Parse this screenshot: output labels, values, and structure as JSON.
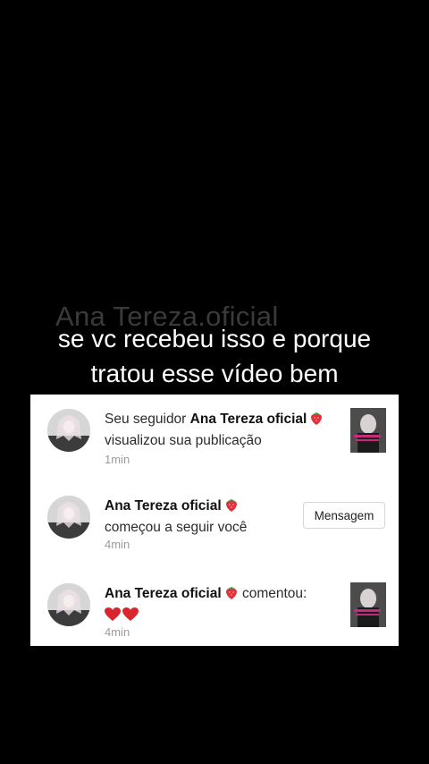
{
  "overlay": {
    "watermark": "Ana Tereza.oficial",
    "caption_line1": "se vc recebeu isso e porque",
    "caption_line2": "tratou esse vídeo bem"
  },
  "notifications": [
    {
      "prefix": "Seu seguidor ",
      "name": "Ana Tereza oficial",
      "icon": "strawberry-icon",
      "line2": "visualizou sua publicação",
      "time": "1min"
    },
    {
      "name": "Ana Tereza oficial",
      "icon": "strawberry-icon",
      "line2": "começou a seguir você",
      "button": "Mensagem",
      "time": "4min"
    },
    {
      "name": "Ana Tereza oficial",
      "icon": "strawberry-icon",
      "action": " comentou:",
      "comment_icons": "heart-icon x2",
      "time": "4min"
    }
  ],
  "colors": {
    "background": "#000000",
    "panel": "#ffffff",
    "heart": "#d9262c",
    "strawberry": "#e0303a"
  }
}
